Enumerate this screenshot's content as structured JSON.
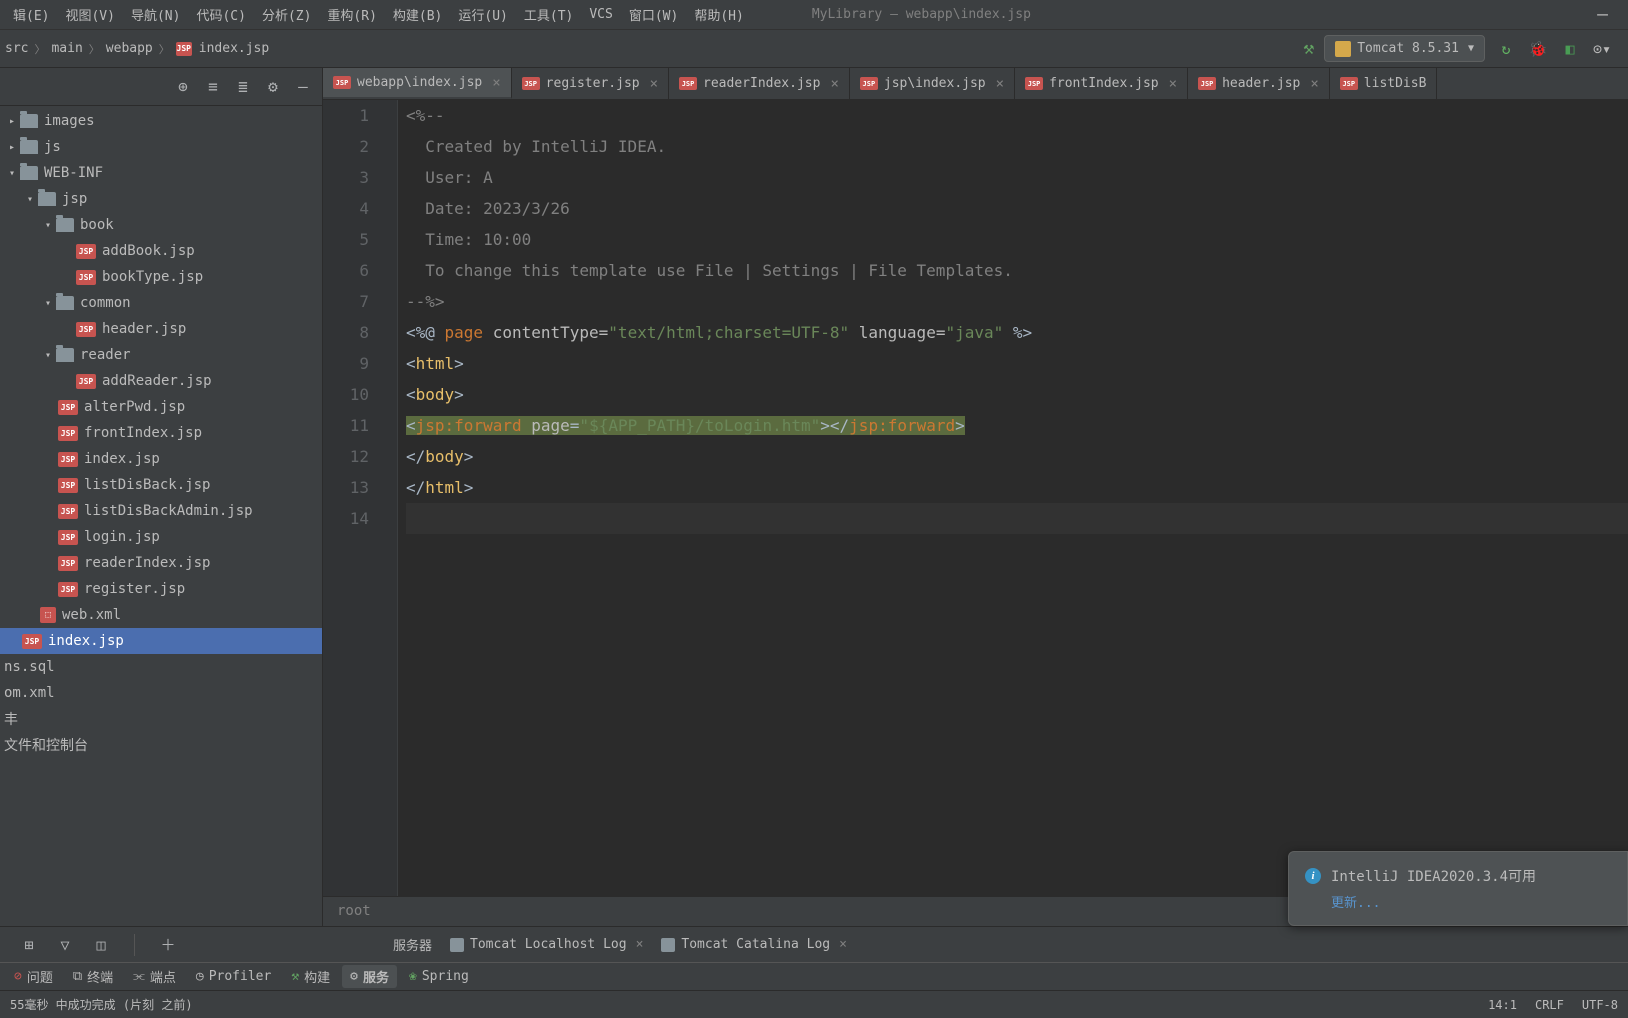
{
  "menu": {
    "items": [
      "辑(E)",
      "视图(V)",
      "导航(N)",
      "代码(C)",
      "分析(Z)",
      "重构(R)",
      "构建(B)",
      "运行(U)",
      "工具(T)",
      "VCS",
      "窗口(W)",
      "帮助(H)"
    ],
    "title": "MyLibrary – webapp\\index.jsp"
  },
  "breadcrumb": [
    "src",
    "main",
    "webapp",
    "index.jsp"
  ],
  "run_config": "Tomcat 8.5.31",
  "tree": {
    "images": "images",
    "js": "js",
    "webinf": "WEB-INF",
    "jsp": "jsp",
    "book": "book",
    "addBook": "addBook.jsp",
    "bookType": "bookType.jsp",
    "common": "common",
    "header": "header.jsp",
    "reader": "reader",
    "addReader": "addReader.jsp",
    "alterPwd": "alterPwd.jsp",
    "frontIndex": "frontIndex.jsp",
    "index": "index.jsp",
    "listDisBack": "listDisBack.jsp",
    "listDisBackAdmin": "listDisBackAdmin.jsp",
    "login": "login.jsp",
    "readerIndex": "readerIndex.jsp",
    "register": "register.jsp",
    "webxml": "web.xml",
    "index2": "index.jsp",
    "nssql": "ns.sql",
    "omxml": "om.xml",
    "unknown": "丰",
    "console": "文件和控制台"
  },
  "tabs": [
    {
      "label": "webapp\\index.jsp",
      "active": true
    },
    {
      "label": "register.jsp",
      "active": false
    },
    {
      "label": "readerIndex.jsp",
      "active": false
    },
    {
      "label": "jsp\\index.jsp",
      "active": false
    },
    {
      "label": "frontIndex.jsp",
      "active": false
    },
    {
      "label": "header.jsp",
      "active": false
    },
    {
      "label": "listDisB",
      "active": false
    }
  ],
  "code": {
    "l1": "<%--",
    "l2": "  Created by IntelliJ IDEA.",
    "l3": "  User: A",
    "l4": "  Date: 2023/3/26",
    "l5": "  Time: 10:00",
    "l6": "  To change this template use File | Settings | File Templates.",
    "l7": "--%>",
    "l8_pre": "<%@ ",
    "l8_page": "page",
    "l8_ct": " contentType=",
    "l8_ctv": "\"text/html;charset=UTF-8\"",
    "l8_lang": " language=",
    "l8_langv": "\"java\"",
    "l8_end": " %>",
    "l9_open": "<",
    "l9_tag": "html",
    "l9_close": ">",
    "l10_open": "<",
    "l10_tag": "body",
    "l10_close": ">",
    "l11_open": "<",
    "l11_jsp": "jsp:forward",
    "l11_page": " page",
    "l11_eq": "=",
    "l11_q1": "\"",
    "l11_expr": "${APP_PATH}",
    "l11_path": "/toLogin.htm",
    "l11_q2": "\"",
    "l11_mid": "></",
    "l11_jsp2": "jsp:forward",
    "l11_end": ">",
    "l12": "</",
    "l12_tag": "body",
    "l12_close": ">",
    "l13": "</",
    "l13_tag": "html",
    "l13_close": ">"
  },
  "context": "root",
  "bottom_tabs": {
    "server": "服务器",
    "localhost": "Tomcat Localhost Log",
    "catalina": "Tomcat Catalina Log"
  },
  "toolwin": {
    "problems": "问题",
    "terminal": "终端",
    "endpoints": "端点",
    "profiler": "Profiler",
    "build": "构建",
    "services": "服务",
    "spring": "Spring"
  },
  "notification": {
    "title": "IntelliJ IDEA2020.3.4可用",
    "action": "更新..."
  },
  "statusbar": {
    "msg": "55毫秒 中成功完成 (片刻 之前)",
    "pos": "14:1",
    "sep": "CRLF",
    "enc": "UTF-8"
  }
}
